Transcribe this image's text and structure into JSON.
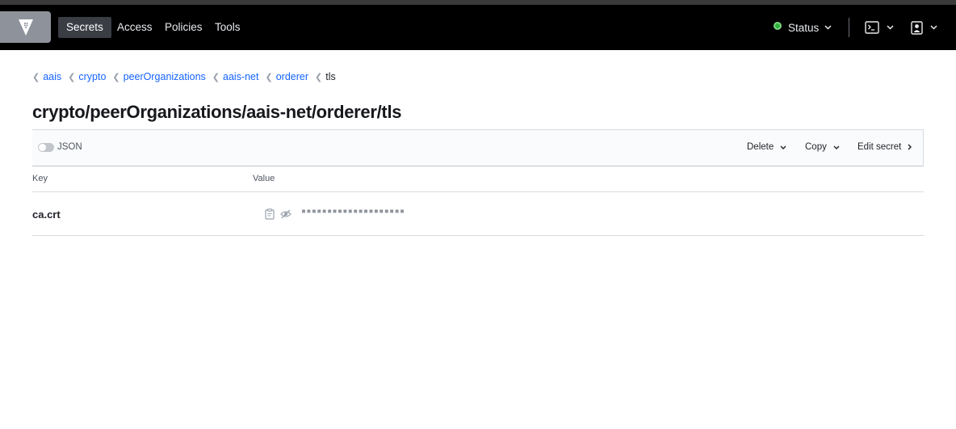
{
  "header": {
    "nav_items": [
      "Secrets",
      "Access",
      "Policies",
      "Tools"
    ],
    "active_nav": "Secrets",
    "status_label": "Status",
    "status_color": "#2eb039",
    "icons": [
      "vault-logo-icon",
      "terminal-icon",
      "user-icon",
      "chevron-down-icon"
    ]
  },
  "breadcrumb": {
    "items": [
      "aais",
      "crypto",
      "peerOrganizations",
      "aais-net",
      "orderer"
    ],
    "current": "tls"
  },
  "page_title": "crypto/peerOrganizations/aais-net/orderer/tls",
  "toolbar": {
    "json_label": "JSON",
    "json_toggle_on": false,
    "delete_label": "Delete",
    "copy_label": "Copy",
    "edit_label": "Edit secret"
  },
  "table": {
    "columns": [
      "Key",
      "Value"
    ],
    "rows": [
      {
        "key": "ca.crt",
        "value_masked": "▪▪▪▪▪▪▪▪▪▪▪▪▪▪▪▪▪▪▪▪"
      }
    ]
  },
  "colors": {
    "link": "#1563ff",
    "nav_bg": "#000000",
    "active_nav_bg": "#3b3d45"
  }
}
